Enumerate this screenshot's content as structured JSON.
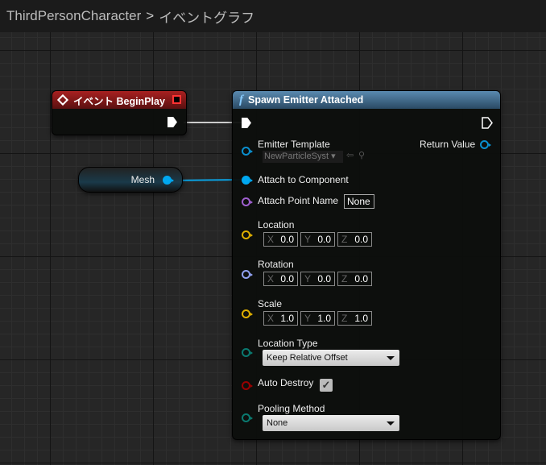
{
  "breadcrumb": {
    "root": "ThirdPersonCharacter",
    "separator": ">",
    "current": "イベントグラフ"
  },
  "event_node": {
    "title": "イベント BeginPlay",
    "color": "#8b1a1a"
  },
  "mesh_node": {
    "label": "Mesh",
    "pin_color": "#00a8f0"
  },
  "function_node": {
    "title": "Spawn Emitter Attached",
    "icon": "f",
    "color": "#3a6a8c",
    "return_value": "Return Value",
    "emitter_template": {
      "label": "Emitter Template",
      "value": "NewParticleSyst"
    },
    "attach_to_component": "Attach to Component",
    "attach_point_name": {
      "label": "Attach Point Name",
      "value": "None"
    },
    "location": {
      "label": "Location",
      "x": "0.0",
      "y": "0.0",
      "z": "0.0"
    },
    "rotation": {
      "label": "Rotation",
      "x": "0.0",
      "y": "0.0",
      "z": "0.0"
    },
    "scale": {
      "label": "Scale",
      "x": "1.0",
      "y": "1.0",
      "z": "1.0"
    },
    "location_type": {
      "label": "Location Type",
      "value": "Keep Relative Offset"
    },
    "auto_destroy": {
      "label": "Auto Destroy",
      "checked": true
    },
    "pooling_method": {
      "label": "Pooling Method",
      "value": "None"
    }
  },
  "axes": {
    "x": "X",
    "y": "Y",
    "z": "Z"
  }
}
